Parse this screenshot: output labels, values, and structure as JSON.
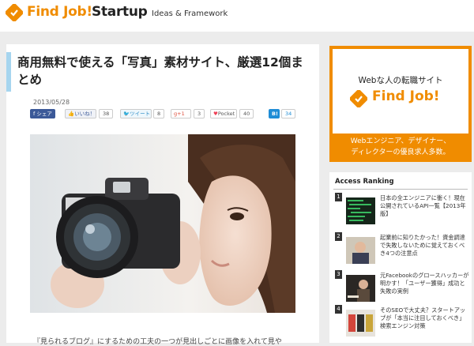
{
  "header": {
    "brand": "Find Job!",
    "product": "Startup",
    "tagline": "Ideas & Framework"
  },
  "article": {
    "title": "商用無料で使える「写真」素材サイト、厳選12個まとめ",
    "date": "2013/05/28",
    "share": {
      "facebook_label": "シェア",
      "like_label": "いいね！",
      "like_count": "38",
      "tweet_label": "ツイート",
      "tweet_count": "8",
      "gplus_label": "+1",
      "gplus_count": "3",
      "pocket_label": "Pocket",
      "pocket_count": "40",
      "hatena_label": "B!",
      "hatena_count": "34"
    },
    "body_excerpt": "『見られるブログ』にするための工夫の一つが見出しごとに画像を入れて見や"
  },
  "ad": {
    "line1": "Webな人の転職サイト",
    "brand": "Find Job!",
    "line2": "Webエンジニア、デザイナー、",
    "line3": "ディレクターの優良求人多数。"
  },
  "ranking": {
    "title": "Access Ranking",
    "items": [
      {
        "num": "1",
        "text": "日本の全エンジニアに衝く！現在公開されているAPI一覧【2013年版】"
      },
      {
        "num": "2",
        "text": "起業前に知りたかった！資金調達で失敗しないために覚えておくべき4つの注意点"
      },
      {
        "num": "3",
        "text": "元Facebookのグロースハッカーが明かす！「ユーザー獲得」成功と失敗の実例"
      },
      {
        "num": "4",
        "text": "そのSEOで大丈夫？スタートアップが「本当に注目しておくべき」検索エンジン対策"
      }
    ]
  },
  "colors": {
    "brand_orange": "#f08c00",
    "title_accent": "#a6d5ef"
  }
}
